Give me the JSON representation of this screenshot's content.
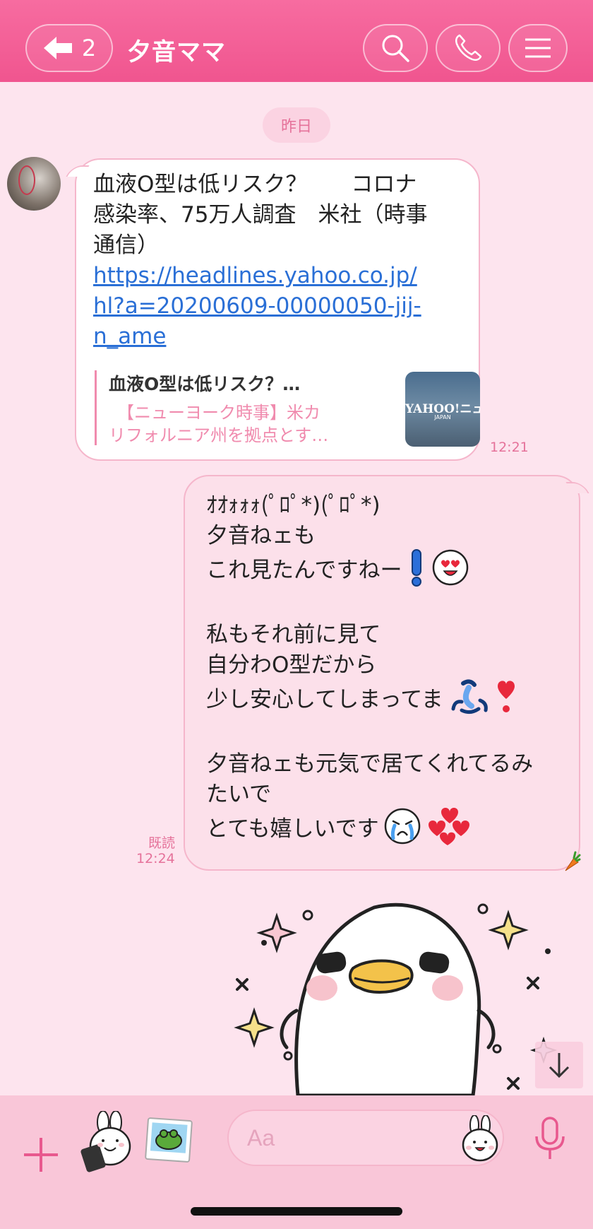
{
  "header": {
    "back_count": "2",
    "title": "夕音ママ",
    "icons": [
      "back-arrow-icon",
      "search-icon",
      "phone-icon",
      "menu-icon"
    ]
  },
  "date_divider": "昨日",
  "incoming_message": {
    "text_lines": [
      "血液O型は低リスク？　　コロナ",
      "感染率、75万人調査　米社（時事",
      "通信）"
    ],
    "link_lines": [
      "https://headlines.yahoo.co.jp/",
      "hl?a=20200609-00000050-jij-",
      "n_ame"
    ],
    "preview": {
      "title": "血液O型は低リスク？…",
      "description_lines": [
        "　【ニューヨーク時事】米カ",
        "リフォルニア州を拠点とす…"
      ],
      "thumb_text": "YAHOO!ニュー",
      "thumb_sub": "JAPAN"
    },
    "time": "12:21"
  },
  "outgoing_message": {
    "lines": [
      {
        "text": "ｵｵｫｫｫ(ﾟﾛﾟ*)(ﾟﾛﾟ*)",
        "emojis": []
      },
      {
        "text": "夕音ねェも",
        "emojis": []
      },
      {
        "text": "これ見たんですねー",
        "emojis": [
          "exclamation-icon",
          "heart-eyes-icon"
        ]
      },
      {
        "text": "",
        "emojis": []
      },
      {
        "text": "私もそれ前に見て",
        "emojis": []
      },
      {
        "text": "自分わO型だから",
        "emojis": []
      },
      {
        "text": "少し安心してしまってま",
        "emojis": [
          "fu-glyph-icon",
          "heart-exclamation-icon"
        ]
      },
      {
        "text": "",
        "emojis": []
      },
      {
        "text": "夕音ねェも元気で居てくれてるみ",
        "emojis": []
      },
      {
        "text": "たいで",
        "emojis": []
      },
      {
        "text": "とても嬉しいです",
        "emojis": [
          "crying-face-icon",
          "hearts-cluster-icon"
        ]
      }
    ],
    "read_label": "既読",
    "time": "12:24"
  },
  "input": {
    "placeholder": "Aa"
  },
  "colors": {
    "header": "#f0558f",
    "background": "#fde4ee",
    "accent": "#e5729a",
    "link": "#2a6fd6",
    "outgoing_bubble": "#fce0ea"
  }
}
